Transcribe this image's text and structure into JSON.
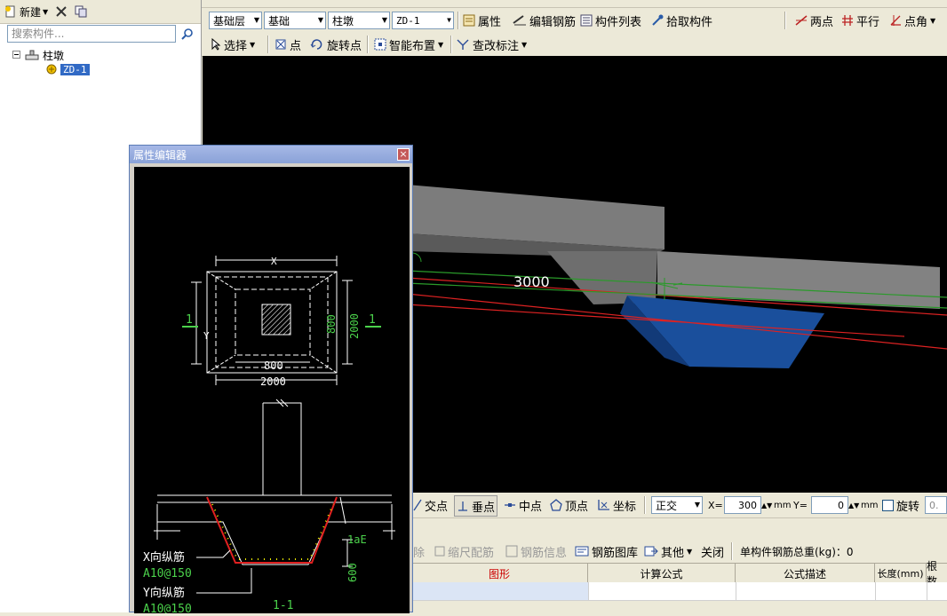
{
  "left_panel": {
    "new_label": "新建",
    "search_placeholder": "搜索构件...",
    "tree_root": "柱墩",
    "tree_child": "ZD-1"
  },
  "toolbar1": {
    "floor": "基础层",
    "category": "基础",
    "type": "柱墩",
    "component": "ZD-1",
    "properties": "属性",
    "edit_rebar": "编辑钢筋",
    "component_list": "构件列表",
    "pick_component": "拾取构件",
    "two_points": "两点",
    "parallel": "平行",
    "point_angle": "点角"
  },
  "toolbar2": {
    "select": "选择",
    "point": "点",
    "rotate_point": "旋转点",
    "smart_layout": "智能布置",
    "edit_annotation": "查改标注"
  },
  "viewport": {
    "dimension": "3000"
  },
  "snapbar": {
    "intersection": "交点",
    "perpendicular": "垂点",
    "midpoint": "中点",
    "vertex": "顶点",
    "coordinate": "坐标",
    "ortho": "正交",
    "x_label": "X=",
    "x_value": "300",
    "y_label": "Y=",
    "y_value": "0",
    "unit": "mm",
    "rotate": "旋转",
    "rotate_value": "0."
  },
  "rebar_toolbar": {
    "delete": "除",
    "scale_rebar": "缩尺配筋",
    "rebar_info": "钢筋信息",
    "rebar_library": "钢筋图库",
    "other": "其他",
    "close": "关闭",
    "total_weight": "单构件钢筋总重(kg)：0"
  },
  "grid": {
    "headers": [
      "图形",
      "计算公式",
      "公式描述",
      "长度(mm)",
      "根数"
    ]
  },
  "dialog": {
    "title": "属性编辑器",
    "close_glyph": "×",
    "label_x": "X",
    "label_y": "Y",
    "dim_800_h": "800",
    "dim_2000_h": "2000",
    "dim_800_v": "800",
    "dim_2000_v": "2000",
    "section_mark": "1",
    "lae": "1aE",
    "dim_600": "600",
    "x_rebar": "X向纵筋",
    "x_rebar_spec": "A10@150",
    "y_rebar": "Y向纵筋",
    "y_rebar_spec": "A10@150",
    "section_title": "1-1"
  }
}
